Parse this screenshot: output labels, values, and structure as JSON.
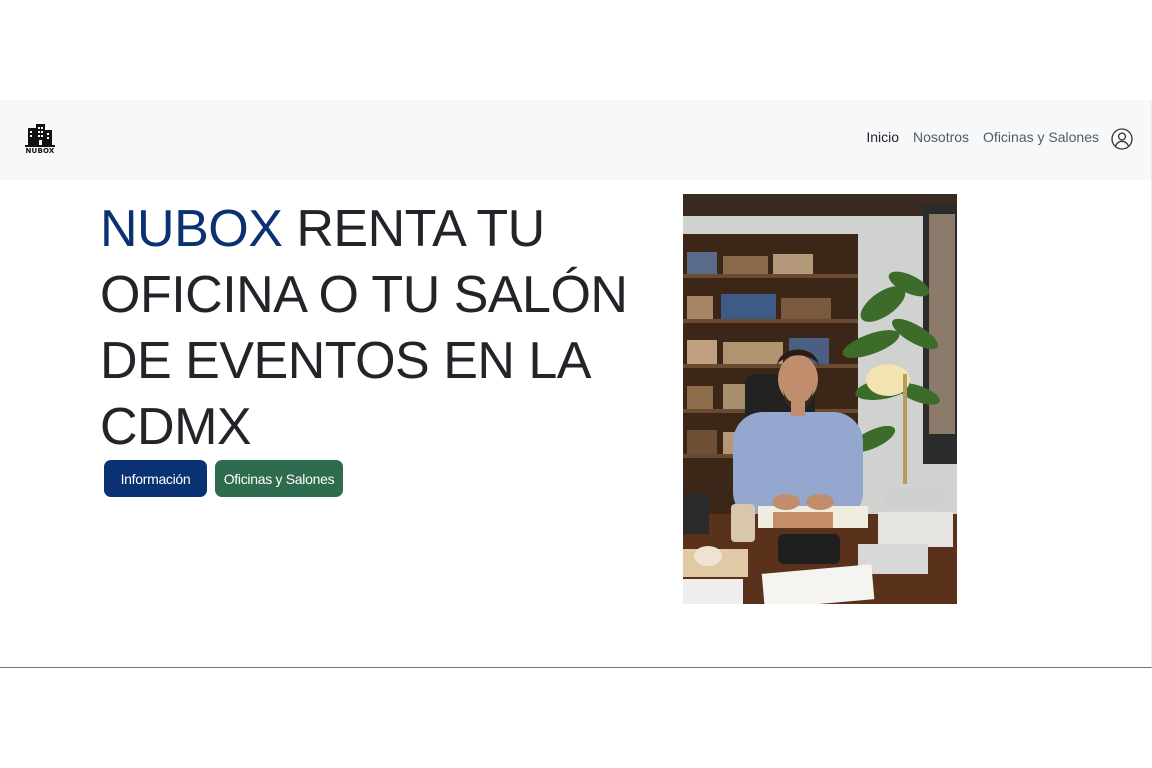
{
  "brand": {
    "logo_icon": "building-logo-icon",
    "name": "NUBOX"
  },
  "nav": {
    "items": [
      {
        "label": "Inicio",
        "active": true
      },
      {
        "label": "Nosotros",
        "active": false
      },
      {
        "label": "Oficinas y Salones",
        "active": false
      }
    ],
    "user_icon": "user-circle-icon"
  },
  "hero": {
    "title_brand": "NUBOX",
    "title_rest": " RENTA TU OFICINA O TU SALÓN DE EVENTOS EN LA CDMX",
    "buttons": {
      "info_label": "Información",
      "offices_label": "Oficinas y Salones"
    },
    "image_subject": "man-at-office-desk-photo"
  },
  "colors": {
    "brand_blue": "#0a3173",
    "button_green": "#2e6b4f",
    "navbar_bg": "#f7f8f9",
    "text_dark": "#212529"
  }
}
